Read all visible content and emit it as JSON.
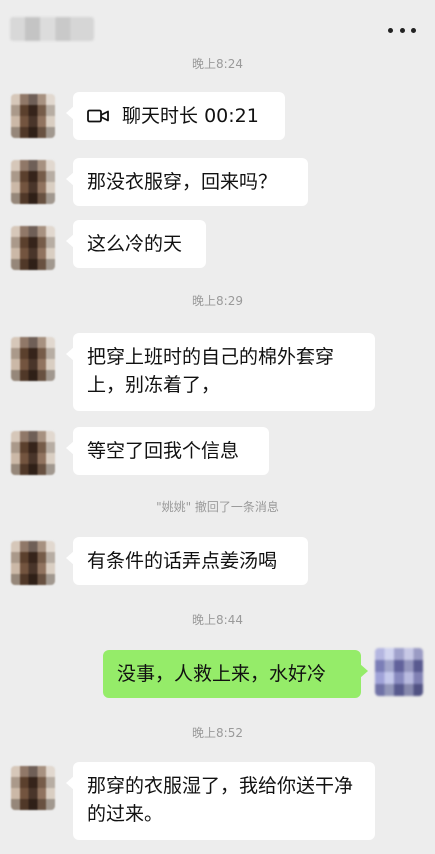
{
  "header": {
    "title": "姚姚"
  },
  "timestamps": {
    "t1": "晚上8:24",
    "t2": "晚上8:29",
    "t3": "晚上8:44",
    "t4": "晚上8:52"
  },
  "messages": [
    {
      "sender": "other",
      "text": "聊天时长 00:21",
      "icon": "video-icon"
    },
    {
      "sender": "other",
      "text": "那没衣服穿，回来吗？"
    },
    {
      "sender": "other",
      "text": "这么冷的天"
    },
    {
      "sender": "other",
      "text": "把穿上班时的自己的棉外套穿上，别冻着了，"
    },
    {
      "sender": "other",
      "text": "等空了回我个信息"
    },
    {
      "sender": "other",
      "text": "有条件的话弄点姜汤喝"
    },
    {
      "sender": "self",
      "text": "没事，人救上来，水好冷"
    },
    {
      "sender": "other",
      "text": "那穿的衣服湿了，我给你送干净的过来。"
    }
  ],
  "recall_notice": "\"姚姚\" 撤回了一条消息",
  "colors": {
    "background": "#ededed",
    "bubble_other": "#ffffff",
    "bubble_self": "#95ec69",
    "timestamp_text": "#9a9a9a",
    "message_text": "#111111"
  },
  "icons": {
    "more": "more-icon",
    "call": "video-icon"
  }
}
